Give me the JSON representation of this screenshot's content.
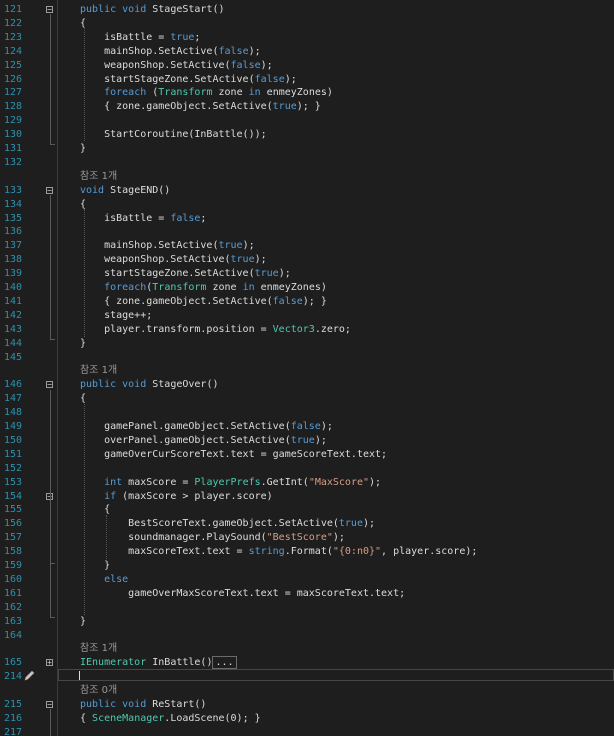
{
  "editor": {
    "colors": {
      "background": "#1e1e1e",
      "line_number": "#2b91af",
      "keyword": "#569cd6",
      "type": "#4ec9b0",
      "string": "#d69d85",
      "default": "#dcdcdc",
      "reference_lens": "#999999"
    },
    "icons": {
      "collapse": "minus-box-icon",
      "expand": "plus-box-icon",
      "edit": "pencil-icon"
    },
    "lines": [
      {
        "num": "121",
        "fold": "collapse",
        "tokens": [
          {
            "t": "public",
            "c": "kw"
          },
          {
            "t": " "
          },
          {
            "t": "void",
            "c": "kw"
          },
          {
            "t": " StageStart()"
          }
        ]
      },
      {
        "num": "122",
        "tokens": [
          {
            "t": "{"
          }
        ]
      },
      {
        "num": "123",
        "tokens": [
          {
            "t": "    isBattle = "
          },
          {
            "t": "true",
            "c": "kw"
          },
          {
            "t": ";"
          }
        ]
      },
      {
        "num": "124",
        "tokens": [
          {
            "t": "    mainShop.SetActive("
          },
          {
            "t": "false",
            "c": "kw"
          },
          {
            "t": ");"
          }
        ]
      },
      {
        "num": "125",
        "tokens": [
          {
            "t": "    weaponShop.SetActive("
          },
          {
            "t": "false",
            "c": "kw"
          },
          {
            "t": ");"
          }
        ]
      },
      {
        "num": "126",
        "tokens": [
          {
            "t": "    startStageZone.SetActive("
          },
          {
            "t": "false",
            "c": "kw"
          },
          {
            "t": ");"
          }
        ]
      },
      {
        "num": "127",
        "tokens": [
          {
            "t": "    "
          },
          {
            "t": "foreach",
            "c": "kw"
          },
          {
            "t": " ("
          },
          {
            "t": "Transform",
            "c": "ty"
          },
          {
            "t": " zone "
          },
          {
            "t": "in",
            "c": "kw"
          },
          {
            "t": " enmeyZones)"
          }
        ]
      },
      {
        "num": "128",
        "tokens": [
          {
            "t": "    { zone.gameObject.SetActive("
          },
          {
            "t": "true",
            "c": "kw"
          },
          {
            "t": "); }"
          }
        ]
      },
      {
        "num": "129",
        "tokens": []
      },
      {
        "num": "130",
        "tokens": [
          {
            "t": "    StartCoroutine(InBattle());"
          }
        ]
      },
      {
        "num": "131",
        "tokens": [
          {
            "t": "}"
          }
        ]
      },
      {
        "num": "132",
        "tokens": []
      },
      {
        "lens": "참조 1개"
      },
      {
        "num": "133",
        "fold": "collapse",
        "tokens": [
          {
            "t": "void",
            "c": "kw"
          },
          {
            "t": " StageEND()"
          }
        ]
      },
      {
        "num": "134",
        "tokens": [
          {
            "t": "{"
          }
        ]
      },
      {
        "num": "135",
        "tokens": [
          {
            "t": "    isBattle = "
          },
          {
            "t": "false",
            "c": "kw"
          },
          {
            "t": ";"
          }
        ]
      },
      {
        "num": "136",
        "tokens": []
      },
      {
        "num": "137",
        "tokens": [
          {
            "t": "    mainShop.SetActive("
          },
          {
            "t": "true",
            "c": "kw"
          },
          {
            "t": ");"
          }
        ]
      },
      {
        "num": "138",
        "tokens": [
          {
            "t": "    weaponShop.SetActive("
          },
          {
            "t": "true",
            "c": "kw"
          },
          {
            "t": ");"
          }
        ]
      },
      {
        "num": "139",
        "tokens": [
          {
            "t": "    startStageZone.SetActive("
          },
          {
            "t": "true",
            "c": "kw"
          },
          {
            "t": ");"
          }
        ]
      },
      {
        "num": "140",
        "tokens": [
          {
            "t": "    "
          },
          {
            "t": "foreach",
            "c": "kw"
          },
          {
            "t": "("
          },
          {
            "t": "Transform",
            "c": "ty"
          },
          {
            "t": " zone "
          },
          {
            "t": "in",
            "c": "kw"
          },
          {
            "t": " enmeyZones)"
          }
        ]
      },
      {
        "num": "141",
        "tokens": [
          {
            "t": "    { zone.gameObject.SetActive("
          },
          {
            "t": "false",
            "c": "kw"
          },
          {
            "t": "); }"
          }
        ]
      },
      {
        "num": "142",
        "tokens": [
          {
            "t": "    stage++;"
          }
        ]
      },
      {
        "num": "143",
        "tokens": [
          {
            "t": "    player.transform.position = "
          },
          {
            "t": "Vector3",
            "c": "ty"
          },
          {
            "t": ".zero;"
          }
        ]
      },
      {
        "num": "144",
        "tokens": [
          {
            "t": "}"
          }
        ]
      },
      {
        "num": "145",
        "tokens": []
      },
      {
        "lens": "참조 1개"
      },
      {
        "num": "146",
        "fold": "collapse",
        "tokens": [
          {
            "t": "public",
            "c": "kw"
          },
          {
            "t": " "
          },
          {
            "t": "void",
            "c": "kw"
          },
          {
            "t": " StageOver()"
          }
        ]
      },
      {
        "num": "147",
        "tokens": [
          {
            "t": "{"
          }
        ]
      },
      {
        "num": "148",
        "tokens": []
      },
      {
        "num": "149",
        "tokens": [
          {
            "t": "    gamePanel.gameObject.SetActive("
          },
          {
            "t": "false",
            "c": "kw"
          },
          {
            "t": ");"
          }
        ]
      },
      {
        "num": "150",
        "tokens": [
          {
            "t": "    overPanel.gameObject.SetActive("
          },
          {
            "t": "true",
            "c": "kw"
          },
          {
            "t": ");"
          }
        ]
      },
      {
        "num": "151",
        "tokens": [
          {
            "t": "    gameOverCurScoreText.text = gameScoreText.text;"
          }
        ]
      },
      {
        "num": "152",
        "tokens": []
      },
      {
        "num": "153",
        "tokens": [
          {
            "t": "    "
          },
          {
            "t": "int",
            "c": "kw"
          },
          {
            "t": " maxScore = "
          },
          {
            "t": "PlayerPrefs",
            "c": "ty"
          },
          {
            "t": ".GetInt("
          },
          {
            "t": "\"MaxScore\"",
            "c": "str"
          },
          {
            "t": ");"
          }
        ]
      },
      {
        "num": "154",
        "fold": "collapse",
        "tokens": [
          {
            "t": "    "
          },
          {
            "t": "if",
            "c": "kw"
          },
          {
            "t": " (maxScore > player.score)"
          }
        ]
      },
      {
        "num": "155",
        "tokens": [
          {
            "t": "    {"
          }
        ]
      },
      {
        "num": "156",
        "tokens": [
          {
            "t": "        BestScoreText.gameObject.SetActive("
          },
          {
            "t": "true",
            "c": "kw"
          },
          {
            "t": ");"
          }
        ]
      },
      {
        "num": "157",
        "tokens": [
          {
            "t": "        soundmanager.PlaySound("
          },
          {
            "t": "\"BestScore\"",
            "c": "str"
          },
          {
            "t": ");"
          }
        ]
      },
      {
        "num": "158",
        "tokens": [
          {
            "t": "        maxScoreText.text = "
          },
          {
            "t": "string",
            "c": "kw"
          },
          {
            "t": ".Format("
          },
          {
            "t": "\"{0:n0}\"",
            "c": "str"
          },
          {
            "t": ", player.score);"
          }
        ]
      },
      {
        "num": "159",
        "tokens": [
          {
            "t": "    }"
          }
        ]
      },
      {
        "num": "160",
        "tokens": [
          {
            "t": "    "
          },
          {
            "t": "else",
            "c": "kw"
          }
        ]
      },
      {
        "num": "161",
        "tokens": [
          {
            "t": "        gameOverMaxScoreText.text = maxScoreText.text;"
          }
        ]
      },
      {
        "num": "162",
        "tokens": []
      },
      {
        "num": "163",
        "tokens": [
          {
            "t": "}"
          }
        ]
      },
      {
        "num": "164",
        "tokens": []
      },
      {
        "lens": "참조 1개"
      },
      {
        "num": "165",
        "fold": "expand",
        "tokens": [
          {
            "t": "IEnumerator",
            "c": "ty"
          },
          {
            "t": " InBattle()"
          },
          {
            "t": "...",
            "c": "box"
          }
        ]
      },
      {
        "num": "214",
        "current": true,
        "tokens": []
      },
      {
        "lens": "참조 0개"
      },
      {
        "num": "215",
        "fold": "collapse",
        "tokens": [
          {
            "t": "public",
            "c": "kw"
          },
          {
            "t": " "
          },
          {
            "t": "void",
            "c": "kw"
          },
          {
            "t": " ReStart()"
          }
        ]
      },
      {
        "num": "216",
        "tokens": [
          {
            "t": "{ "
          },
          {
            "t": "SceneManager",
            "c": "ty"
          },
          {
            "t": ".LoadScene(0); }"
          }
        ]
      },
      {
        "num": "217",
        "tokens": []
      }
    ]
  }
}
